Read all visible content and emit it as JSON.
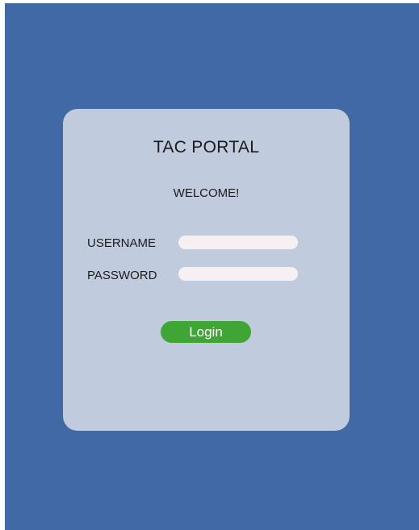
{
  "login_card": {
    "title": "TAC PORTAL",
    "welcome": "WELCOME!",
    "username": {
      "label": "USERNAME",
      "value": "",
      "placeholder": ""
    },
    "password": {
      "label": "PASSWORD",
      "value": "",
      "placeholder": ""
    },
    "login_button_label": "Login"
  },
  "colors": {
    "background": "#4069a5",
    "card": "#c0cbdd",
    "input": "#f6f0f3",
    "button": "#3fa535",
    "button_text": "#ffffff"
  }
}
